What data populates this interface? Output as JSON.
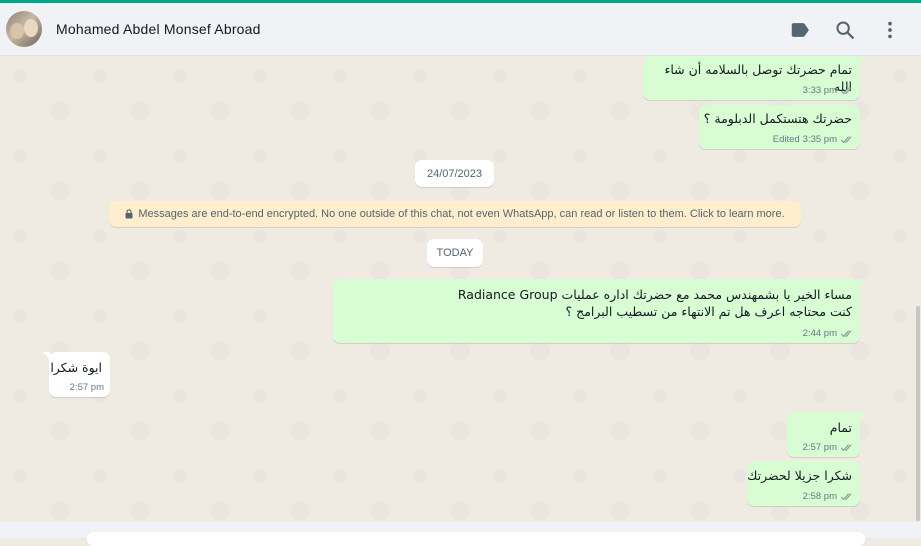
{
  "header": {
    "contact_name": "Mohamed Abdel Monsef Abroad",
    "icons": [
      "label-icon",
      "search-icon",
      "menu-icon"
    ]
  },
  "messages": [
    {
      "direction": "out",
      "text": "تمام حضرتك توصل بالسلامه أن شاء الله",
      "time": "3:33 pm",
      "edited": false
    },
    {
      "direction": "out",
      "text": "حضرتك هتستكمل الدبلومة ؟",
      "time": "3:35 pm",
      "edited_label": "Edited"
    },
    {
      "direction": "out",
      "text": "مساء الخير يا بشمهندس محمد مع حضرتك اداره عمليات Radiance Group\nكنت محتاجه اعرف هل تم الانتهاء من تسطيب البرامج ؟",
      "time": "2:44 pm"
    },
    {
      "direction": "in",
      "text": "ايوة شكرا",
      "time": "2:57 pm"
    },
    {
      "direction": "out",
      "text": "تمام",
      "time": "2:57 pm"
    },
    {
      "direction": "out",
      "text": "شكرا جزيلا لحضرتك",
      "time": "2:58 pm"
    }
  ],
  "date_chips": {
    "first": "24/07/2023",
    "second": "TODAY"
  },
  "encryption_notice": "Messages are end-to-end encrypted. No one outside of this chat, not even WhatsApp, can read or listen to them. Click to learn more.",
  "colors": {
    "accent": "#00a884",
    "outgoing_bubble": "#d9fdd3",
    "incoming_bubble": "#ffffff",
    "chat_background": "#efeae2",
    "encryption_banner": "#ffeecd",
    "read_ticks": "#8696a0"
  }
}
